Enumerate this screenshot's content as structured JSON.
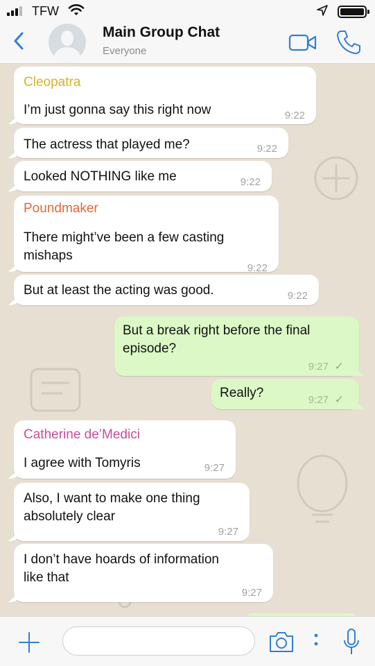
{
  "status_bar": {
    "carrier": "TFW",
    "icons": [
      "signal-bars-icon",
      "wifi-icon",
      "location-arrow-icon",
      "battery-icon"
    ]
  },
  "header": {
    "title": "Main Group Chat",
    "subtitle": "Everyone",
    "icons": [
      "back-chevron-icon",
      "avatar",
      "video-camera-icon",
      "phone-icon"
    ]
  },
  "colors": {
    "accent_blue": "#2f7ed8",
    "incoming_bubble": "#ffffff",
    "outgoing_bubble": "#dcf8c6",
    "cleopatra": "#d4b429",
    "poundmaker": "#e0673a",
    "catherine": "#c94e97"
  },
  "messages": [
    {
      "sender": "Cleopatra",
      "text": "I’m just gonna say this right now",
      "time": "9:22",
      "direction": "in"
    },
    {
      "text": "The actress that played me?",
      "time": "9:22",
      "direction": "in"
    },
    {
      "text": "Looked NOTHING like me",
      "time": "9:22",
      "direction": "in"
    },
    {
      "sender": "Poundmaker",
      "text": "There might’ve been a few casting",
      "text2": "mishaps",
      "time": "9:22",
      "direction": "in"
    },
    {
      "text": "But at least the acting was good.",
      "time": "9:22",
      "direction": "in"
    },
    {
      "text": "But a break right before the final",
      "text2": "episode?",
      "time": "9:27",
      "direction": "out"
    },
    {
      "text": "Really?",
      "time": "9:27",
      "direction": "out"
    },
    {
      "sender": "Catherine de’Medici",
      "text": "I agree with Tomyris",
      "time": "9:27",
      "direction": "in"
    },
    {
      "text": "Also, I want to make one thing",
      "text2": "absolutely clear",
      "time": "9:27",
      "direction": "in"
    },
    {
      "text": "I don’t have hoards of information",
      "text2": "like that",
      "time": "9:27",
      "direction": "in"
    }
  ],
  "input_bar": {
    "placeholder": "",
    "icons": [
      "plus-icon",
      "camera-icon",
      "more-dots-icon",
      "microphone-icon"
    ]
  }
}
